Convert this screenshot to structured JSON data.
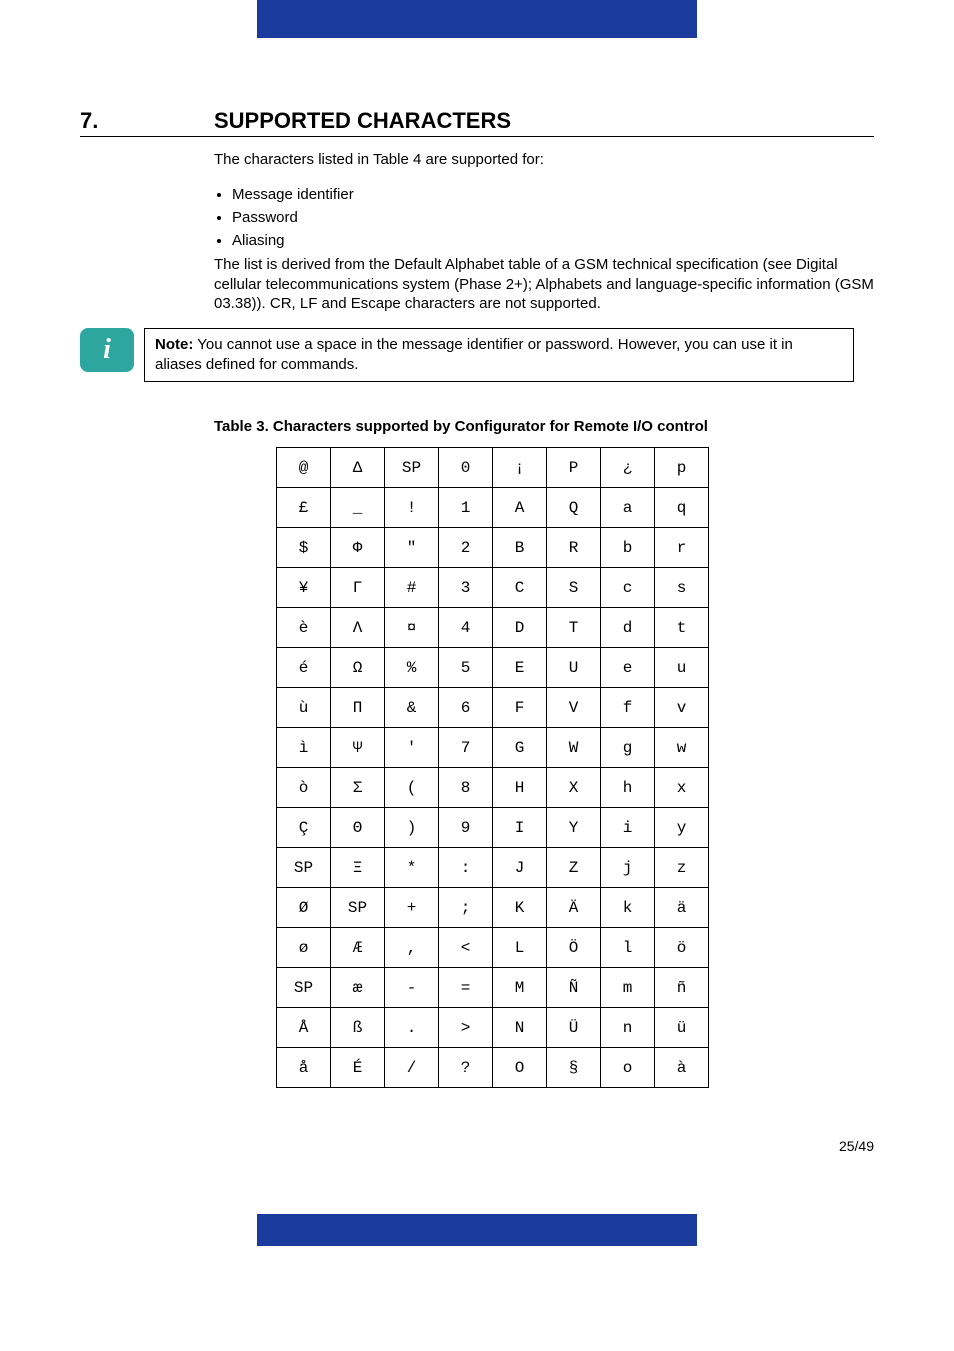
{
  "section": {
    "number": "7.",
    "title": "SUPPORTED CHARACTERS"
  },
  "intro": "The characters listed in Table 4 are supported for:",
  "bullets": [
    "Message identifier",
    "Password",
    "Aliasing"
  ],
  "desc": "The list is derived from the Default Alphabet table of a GSM technical specification (see Digital cellular telecommunications system (Phase 2+); Alphabets and language-specific information (GSM 03.38)). CR, LF and Escape characters are not supported.",
  "note_label": "Note:",
  "note_text": " You cannot use a space in the message identifier or password. However, you can use it in aliases defined for commands.",
  "table_caption": "Table 3. Characters supported by Configurator for Remote I/O control",
  "page_num": "25/49",
  "chart_data": {
    "type": "table",
    "title": "Characters supported by Configurator for Remote I/O control",
    "rows": [
      [
        "@",
        "Δ",
        "SP",
        "0",
        "¡",
        "P",
        "¿",
        "p"
      ],
      [
        "£",
        "_",
        "!",
        "1",
        "A",
        "Q",
        "a",
        "q"
      ],
      [
        "$",
        "Φ",
        "\"",
        "2",
        "B",
        "R",
        "b",
        "r"
      ],
      [
        "¥",
        "Γ",
        "#",
        "3",
        "C",
        "S",
        "c",
        "s"
      ],
      [
        "è",
        "Λ",
        "¤",
        "4",
        "D",
        "T",
        "d",
        "t"
      ],
      [
        "é",
        "Ω",
        "%",
        "5",
        "E",
        "U",
        "e",
        "u"
      ],
      [
        "ù",
        "Π",
        "&",
        "6",
        "F",
        "V",
        "f",
        "v"
      ],
      [
        "ì",
        "Ψ",
        "'",
        "7",
        "G",
        "W",
        "g",
        "w"
      ],
      [
        "ò",
        "Σ",
        "(",
        "8",
        "H",
        "X",
        "h",
        "x"
      ],
      [
        "Ç",
        "Θ",
        ")",
        "9",
        "I",
        "Y",
        "i",
        "y"
      ],
      [
        "SP",
        "Ξ",
        "*",
        ":",
        "J",
        "Z",
        "j",
        "z"
      ],
      [
        "Ø",
        "SP",
        "+",
        ";",
        "K",
        "Ä",
        "k",
        "ä"
      ],
      [
        "ø",
        "Æ",
        ",",
        "<",
        "L",
        "Ö",
        "l",
        "ö"
      ],
      [
        "SP",
        "æ",
        "-",
        "=",
        "M",
        "Ñ",
        "m",
        "ñ"
      ],
      [
        "Å",
        "ß",
        ".",
        ">",
        "N",
        "Ü",
        "n",
        "ü"
      ],
      [
        "å",
        "É",
        "/",
        "?",
        "O",
        "§",
        "o",
        "à"
      ]
    ]
  }
}
